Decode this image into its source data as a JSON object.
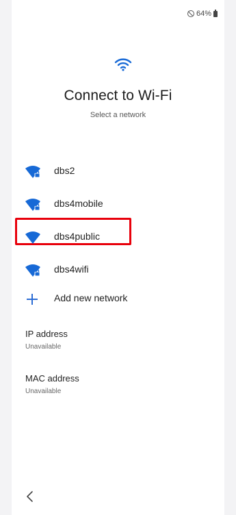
{
  "status_bar": {
    "battery_text": "64%",
    "icons": [
      "do-not-disturb-icon",
      "battery-icon"
    ]
  },
  "header": {
    "icon": "wifi-icon",
    "title": "Connect to Wi-Fi",
    "subtitle": "Select a network"
  },
  "networks": [
    {
      "name": "dbs2",
      "secured": true
    },
    {
      "name": "dbs4mobile",
      "secured": true
    },
    {
      "name": "dbs4public",
      "secured": false,
      "highlighted": true
    },
    {
      "name": "dbs4wifi",
      "secured": true
    }
  ],
  "add_network": {
    "label": "Add new network",
    "icon": "plus-icon"
  },
  "ip_address": {
    "label": "IP address",
    "value": "Unavailable"
  },
  "mac_address": {
    "label": "MAC address",
    "value": "Unavailable"
  },
  "nav": {
    "back_icon": "back-chevron-icon"
  },
  "colors": {
    "accent": "#2b6cd4",
    "highlight": "#e8000b",
    "wifi_blue": "#1769d6"
  }
}
